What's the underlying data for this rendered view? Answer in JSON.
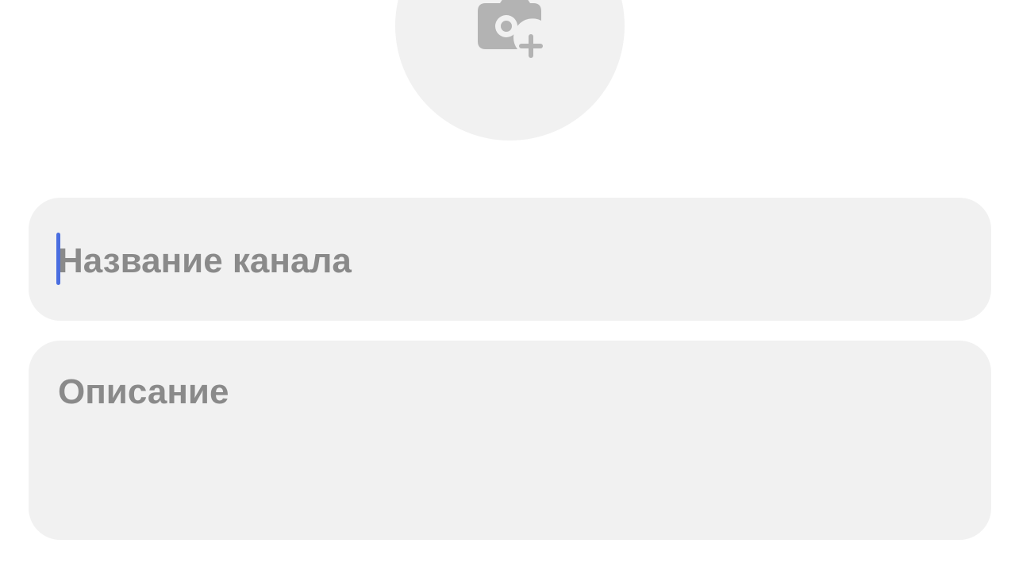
{
  "avatar": {
    "icon": "camera-add-icon"
  },
  "form": {
    "name_placeholder": "Название канала",
    "description_placeholder": "Описание"
  },
  "colors": {
    "field_background": "#f1f1f1",
    "placeholder_text": "#8a8a8a",
    "icon": "#b3b3b3",
    "cursor": "#4a6ee0"
  }
}
